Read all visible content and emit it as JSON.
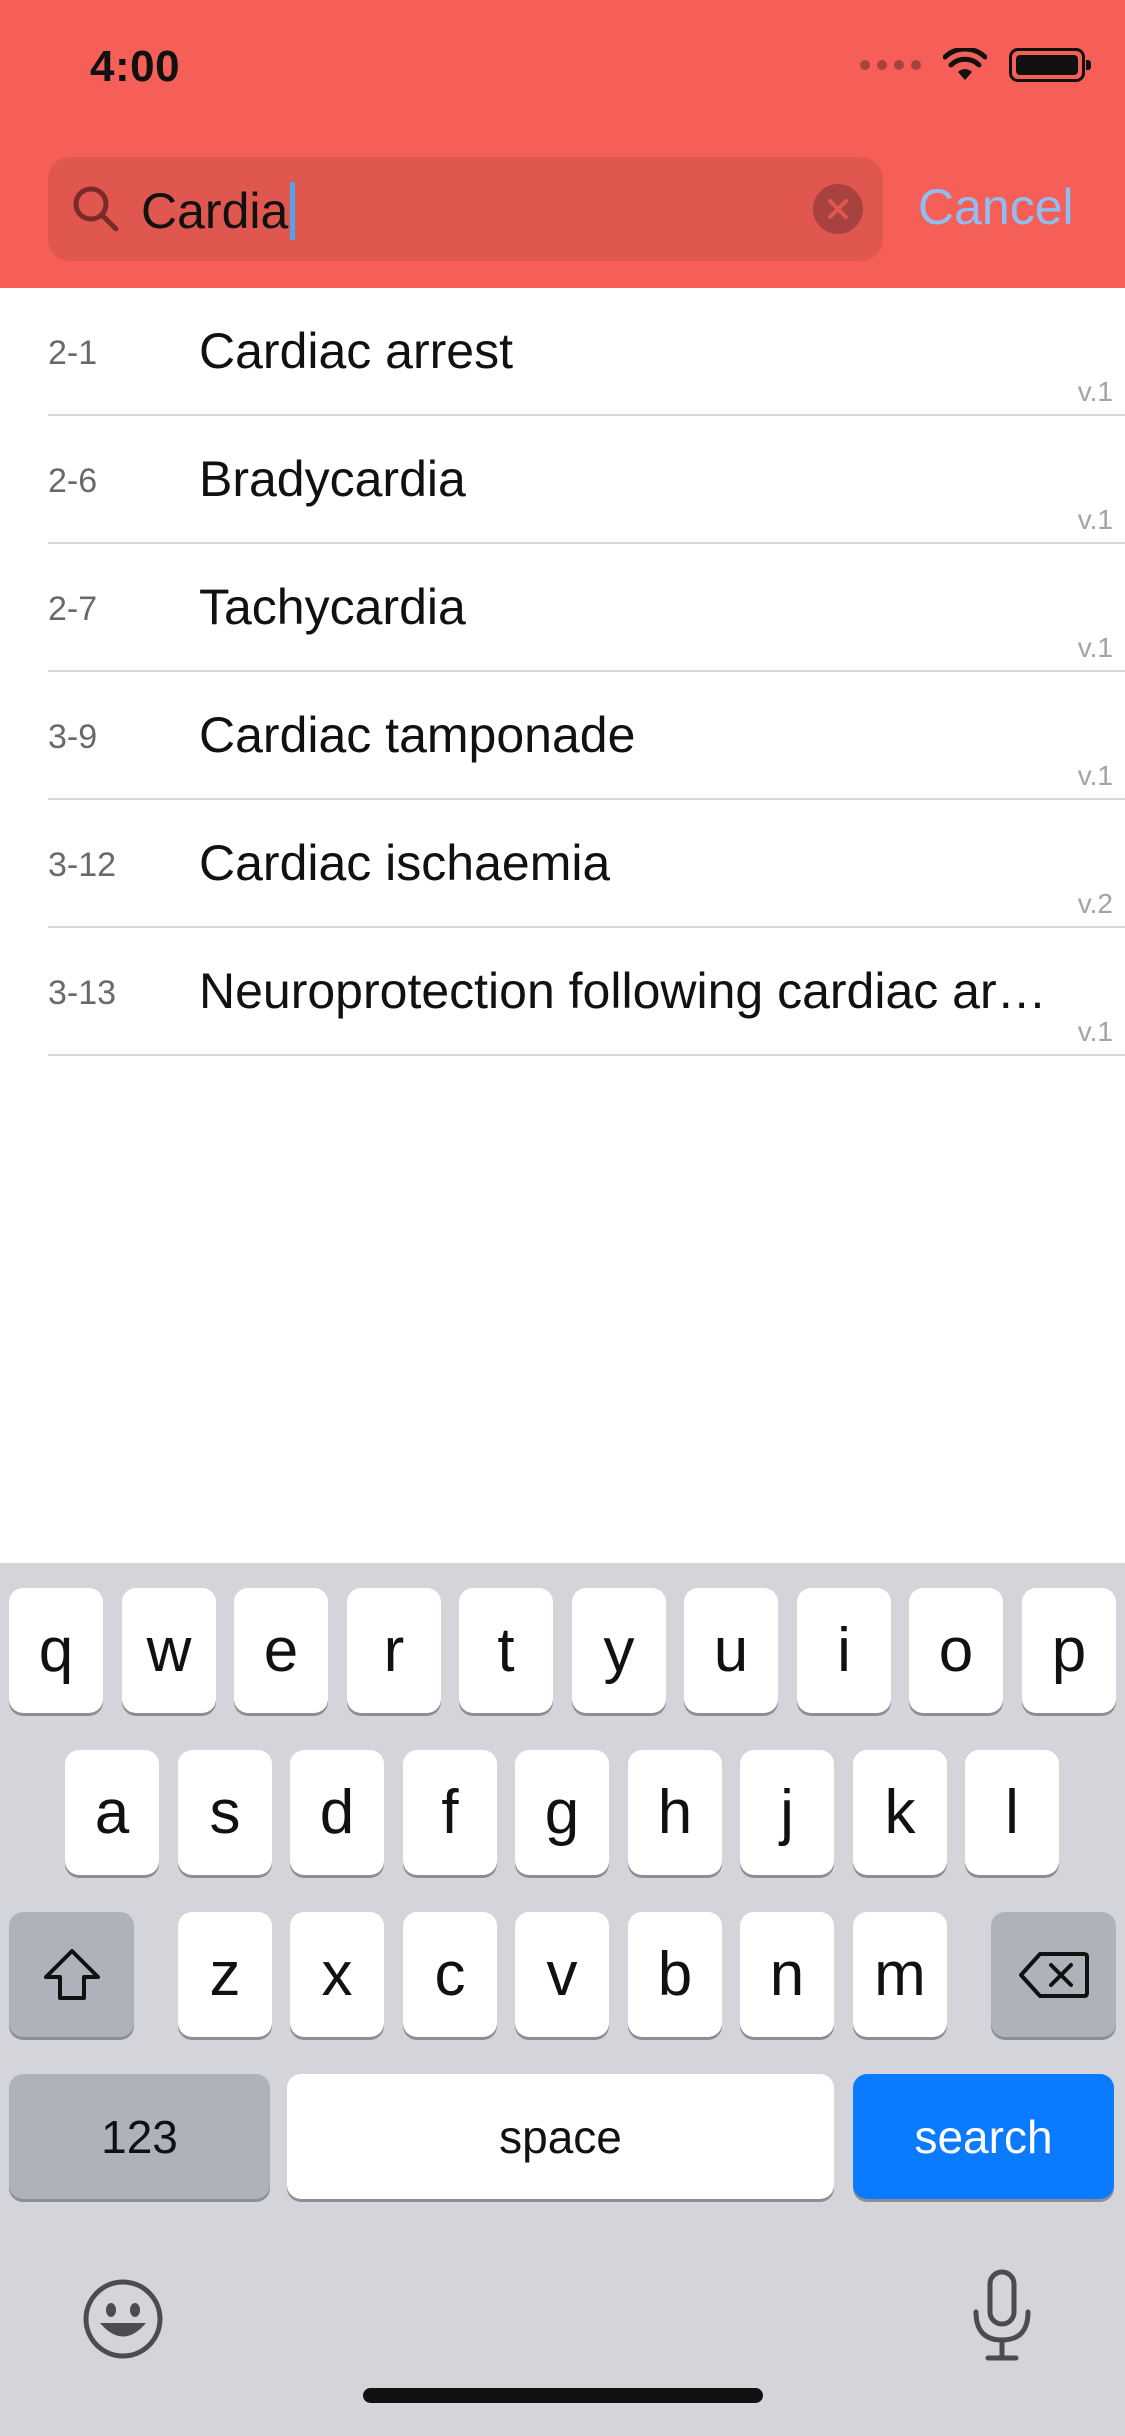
{
  "status_bar": {
    "time": "4:00"
  },
  "search": {
    "query": "Cardia",
    "cancel_label": "Cancel"
  },
  "results": [
    {
      "code": "2-1",
      "title": "Cardiac arrest",
      "version": "v.1"
    },
    {
      "code": "2-6",
      "title": "Bradycardia",
      "version": "v.1"
    },
    {
      "code": "2-7",
      "title": "Tachycardia",
      "version": "v.1"
    },
    {
      "code": "3-9",
      "title": "Cardiac tamponade",
      "version": "v.1"
    },
    {
      "code": "3-12",
      "title": "Cardiac ischaemia",
      "version": "v.2"
    },
    {
      "code": "3-13",
      "title": "Neuroprotection following cardiac ar…",
      "version": "v.1"
    }
  ],
  "keyboard": {
    "row1": [
      "q",
      "w",
      "e",
      "r",
      "t",
      "y",
      "u",
      "i",
      "o",
      "p"
    ],
    "row2": [
      "a",
      "s",
      "d",
      "f",
      "g",
      "h",
      "j",
      "k",
      "l"
    ],
    "row3": [
      "z",
      "x",
      "c",
      "v",
      "b",
      "n",
      "m"
    ],
    "numbers_label": "123",
    "space_label": "space",
    "search_label": "search"
  },
  "colors": {
    "header": "#f65f58",
    "accent": "#0a7aff",
    "cancel": "#8fbff2"
  }
}
